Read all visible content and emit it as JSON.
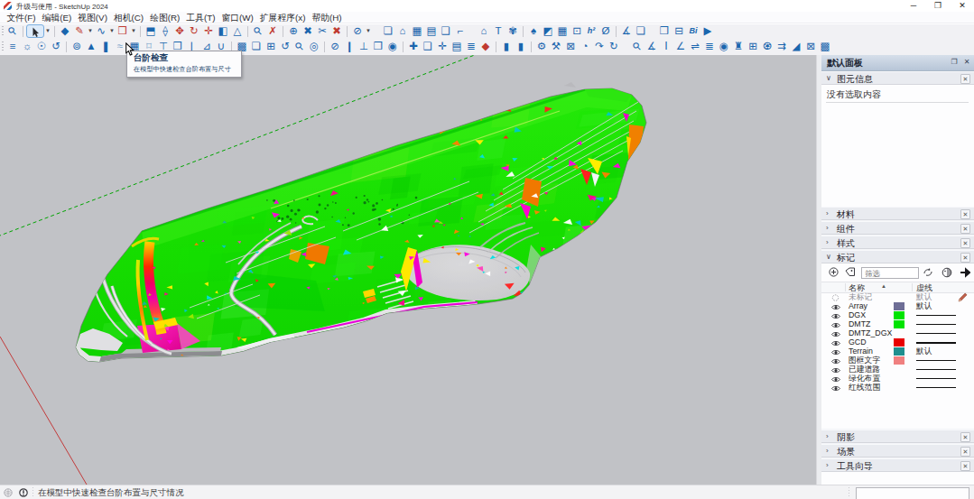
{
  "window": {
    "title": "升级与使用 - SketchUp 2024",
    "minimize_glyph": "─",
    "maximize_glyph": "❐",
    "close_glyph": "✕"
  },
  "menu": {
    "items": [
      "文件(F)",
      "编辑(E)",
      "视图(V)",
      "相机(C)",
      "绘图(R)",
      "工具(T)",
      "窗口(W)",
      "扩展程序(x)",
      "帮助(H)"
    ]
  },
  "toolbar1": {
    "items": [
      {
        "grip": 1
      },
      {
        "n": "zoom-tool",
        "g": "⚲",
        "c": "b",
        "rot": 1
      },
      {
        "sep": 1
      },
      {
        "n": "select-tool",
        "sel": 1
      },
      {
        "n": "select-dropdown",
        "dd": 1
      },
      {
        "sep": 1
      },
      {
        "n": "eraser-tool",
        "g": "◆",
        "c": "b"
      },
      {
        "n": "line-tool",
        "g": "✎",
        "c": "r"
      },
      {
        "n": "line-dropdown",
        "dd": 1
      },
      {
        "n": "arc-tool",
        "g": "∿",
        "c": "b"
      },
      {
        "n": "arc-dropdown",
        "dd": 1
      },
      {
        "n": "rectangle-tool",
        "g": "❒",
        "c": "r"
      },
      {
        "n": "rectangle-dropdown",
        "dd": 1
      },
      {
        "sep": 1
      },
      {
        "n": "pushpull-tool",
        "g": "⬒",
        "c": "b"
      },
      {
        "n": "followme-tool",
        "g": "⟠",
        "c": "b"
      },
      {
        "n": "scale-tool",
        "g": "✥",
        "c": "r"
      },
      {
        "n": "rotate-tool",
        "g": "↻",
        "c": "r"
      },
      {
        "n": "move-tool",
        "g": "✛",
        "c": "r"
      },
      {
        "n": "offset-tool",
        "g": "◧",
        "c": "b"
      },
      {
        "n": "protractor-tool",
        "g": "△",
        "c": "b"
      },
      {
        "sep": 1
      },
      {
        "n": "tape-measure-tool",
        "g": "⚲",
        "c": "b",
        "rot": 1
      },
      {
        "n": "axes-tool",
        "g": "✗",
        "c": "r"
      },
      {
        "sep": 1
      },
      {
        "n": "orbit-tool",
        "g": "⊕",
        "c": "b"
      },
      {
        "n": "pan-tool",
        "g": "✖",
        "c": "b"
      },
      {
        "n": "zoom-extents-tool",
        "g": "✂",
        "c": "b"
      },
      {
        "n": "previous-view-tool",
        "g": "✖",
        "c": "r"
      },
      {
        "sep": 1
      },
      {
        "n": "position-camera-tool",
        "g": "⊘",
        "c": "b"
      },
      {
        "n": "camera-dropdown",
        "dd": 1
      },
      {
        "gap": 1
      },
      {
        "n": "scene-new-button",
        "g": "❏",
        "c": "b"
      },
      {
        "n": "view-iso-button",
        "g": "⌂",
        "c": "b"
      },
      {
        "n": "view-top-button",
        "g": "▦",
        "c": "b"
      },
      {
        "n": "view-front-button",
        "g": "▤",
        "c": "b"
      },
      {
        "n": "view-right-button",
        "g": "❑",
        "c": "b"
      },
      {
        "n": "view-back-button",
        "g": "⌐",
        "c": "b"
      },
      {
        "gap": 1
      },
      {
        "n": "home-tool",
        "g": "⌂",
        "c": "b"
      },
      {
        "n": "text-tool",
        "g": "T",
        "c": "b"
      },
      {
        "n": "flower-component-button",
        "g": "✾",
        "c": "b"
      },
      {
        "sep": 1
      },
      {
        "n": "tree-component-button",
        "g": "♠",
        "c": "b"
      },
      {
        "n": "cube-tool",
        "g": "◩",
        "c": "b"
      },
      {
        "n": "fence-grid-tool",
        "g": "▦",
        "c": "b"
      },
      {
        "n": "boxed-arrow-tool",
        "g": "⊡",
        "c": "b"
      },
      {
        "n": "curve-h2-tool",
        "g": "h²",
        "c": "b",
        "txt": 1
      },
      {
        "n": "hide-rest-tool",
        "g": "Ø",
        "c": "b"
      },
      {
        "sep": 1
      },
      {
        "n": "walk-tool",
        "g": "∡",
        "c": "b"
      },
      {
        "n": "export-doc-tool",
        "g": "❏",
        "c": "b"
      },
      {
        "gap": 1
      },
      {
        "n": "copy-layers-tool",
        "g": "❐",
        "c": "b"
      },
      {
        "n": "minus-box-tool",
        "g": "⊟",
        "c": "b"
      },
      {
        "n": "bim-tool",
        "g": "Bi",
        "c": "b",
        "txt": 1
      },
      {
        "n": "play-tool",
        "g": "▶",
        "c": "b"
      }
    ]
  },
  "toolbar2": {
    "items": [
      {
        "grip": 1
      },
      {
        "n": "layers-list-tool",
        "g": "≡",
        "c": "b"
      },
      {
        "n": "sun-tool",
        "g": "☼",
        "c": "b"
      },
      {
        "n": "globe-tool",
        "g": "☉",
        "c": "b"
      },
      {
        "n": "select-boundary-tool",
        "g": "↺",
        "c": "b"
      },
      {
        "sep": 1
      },
      {
        "n": "helmet-tool",
        "g": "⊚",
        "c": "b"
      },
      {
        "n": "mountain-photo-tool",
        "g": "▲",
        "c": "b"
      },
      {
        "n": "block-tool",
        "g": "❚",
        "c": "b"
      },
      {
        "n": "wave-tool",
        "g": "≈",
        "c": "m"
      },
      {
        "n": "grid-array-tool",
        "g": "▦",
        "c": "b"
      },
      {
        "n": "hovered-tool",
        "g": "⌑",
        "c": "m"
      },
      {
        "n": "pillar-tool",
        "g": "⊤",
        "c": "b"
      },
      {
        "n": "window-frame-tool",
        "g": "❒",
        "c": "b"
      },
      {
        "n": "stairs-down-tool",
        "g": "⌊",
        "c": "b"
      },
      {
        "n": "ramp-tool",
        "g": "⊿",
        "c": "b"
      },
      {
        "n": "pipe-tool",
        "g": "∪",
        "c": "b"
      },
      {
        "sep": 1
      },
      {
        "n": "wall-tool",
        "g": "▩",
        "c": "b"
      },
      {
        "n": "screen-tool",
        "g": "❏",
        "c": "b"
      },
      {
        "n": "attach-tool",
        "g": "⊞",
        "c": "b"
      },
      {
        "n": "loop-tool",
        "g": "↺",
        "c": "b"
      },
      {
        "n": "magnify-plus-tool",
        "g": "⚲",
        "c": "b",
        "rot": 1
      },
      {
        "n": "download-circle-tool",
        "g": "◎",
        "c": "b"
      },
      {
        "sep": 1
      },
      {
        "n": "link-tool",
        "g": "⊘",
        "c": "b"
      },
      {
        "n": "fence-tool",
        "g": "❙",
        "c": "b"
      },
      {
        "n": "figure-tool",
        "g": "⊥",
        "c": "b"
      },
      {
        "n": "transfer-tool",
        "g": "❐",
        "c": "b"
      },
      {
        "n": "lock-box-tool",
        "g": "◉",
        "c": "b"
      },
      {
        "sep": 1
      },
      {
        "n": "add-wall-tool",
        "g": "✚",
        "c": "b"
      },
      {
        "n": "note-edit-tool",
        "g": "❑",
        "c": "b"
      },
      {
        "n": "cross-move-tool",
        "g": "✛",
        "c": "b"
      },
      {
        "n": "list-table-tool",
        "g": "▤",
        "c": "b"
      },
      {
        "n": "equalizer-tool",
        "g": "≣",
        "c": "b"
      },
      {
        "n": "trash-red-tool",
        "g": "◆",
        "c": "r"
      },
      {
        "sep": 1
      },
      {
        "n": "battery1-tool",
        "g": "▮",
        "c": "b"
      },
      {
        "n": "battery2-tool",
        "g": "▮",
        "c": "b"
      },
      {
        "sep": 1
      },
      {
        "n": "gear-tool",
        "g": "⚙",
        "c": "b"
      },
      {
        "n": "gear-run-tool",
        "g": "⚒",
        "c": "b"
      },
      {
        "n": "photo-match-tool",
        "g": "⊠",
        "c": "b"
      },
      {
        "n": "help-circle-tool",
        "g": "◔",
        "c": "b"
      },
      {
        "n": "cloud-up-tool",
        "g": "↷",
        "c": "b"
      },
      {
        "n": "refresh-tool",
        "g": "↻",
        "c": "b"
      },
      {
        "gap": 1
      },
      {
        "n": "search-big-tool",
        "g": "⚲",
        "c": "b",
        "rot": 1
      },
      {
        "n": "angle-tool",
        "g": "∡",
        "c": "b"
      },
      {
        "n": "height-tool",
        "g": "Ⅰ",
        "c": "b"
      },
      {
        "n": "slope-tool",
        "g": "∠",
        "c": "b"
      },
      {
        "n": "swap-tool",
        "g": "⇌",
        "c": "b"
      },
      {
        "n": "layers-tool",
        "g": "≣",
        "c": "b"
      },
      {
        "n": "lock-tool",
        "g": "◉",
        "c": "b"
      },
      {
        "n": "tower-tool",
        "g": "♜",
        "c": "b"
      },
      {
        "n": "window-grid-tool",
        "g": "⊞",
        "c": "b"
      },
      {
        "n": "trash-can-tool",
        "g": "♼",
        "c": "b"
      },
      {
        "n": "branch-tool",
        "g": "⇉",
        "c": "b"
      },
      {
        "n": "terrain-slope-tool",
        "g": "◢",
        "c": "b"
      },
      {
        "n": "screen-arrow-tool",
        "g": "⊠",
        "c": "b"
      },
      {
        "n": "texture-tool",
        "g": "▩",
        "c": "b"
      }
    ]
  },
  "tooltip": {
    "title": "台阶检查",
    "description": "在模型中快速检查台阶布置与尺寸"
  },
  "viewport": {
    "background": "#c1c2c6",
    "green_axis_color": "#00a400",
    "red_axis_color": "#c23a3a",
    "model_primary_color": "#1ae300"
  },
  "tray": {
    "title": "默认面板",
    "pin_glyph": "❐",
    "close_glyph": "✕",
    "entity_info": {
      "title": "图元信息",
      "empty_text": "没有选取内容"
    },
    "materials": {
      "title": "材料"
    },
    "components": {
      "title": "组件"
    },
    "styles": {
      "title": "样式"
    },
    "tags": {
      "title": "标记",
      "search_placeholder": "筛选",
      "name_column": "名称",
      "dashes_column": "虚线",
      "default_dash_label": "默认",
      "rows": [
        {
          "name": "未标记",
          "untagged": true,
          "dash": "default",
          "active": true
        },
        {
          "name": "Array",
          "color": "#6e6e96",
          "dash": "default"
        },
        {
          "name": "DGX",
          "color": "#00e400",
          "dash": "line"
        },
        {
          "name": "DMTZ",
          "color": "#00e400",
          "dash": "line"
        },
        {
          "name": "DMTZ_DGX",
          "color": "",
          "dash": "line"
        },
        {
          "name": "GCD",
          "color": "#e80000",
          "dash": "thick"
        },
        {
          "name": "Terrain",
          "color": "#1f8f8f",
          "dash": "default"
        },
        {
          "name": "图框文字",
          "color": "#f08080",
          "dash": "line"
        },
        {
          "name": "已建道路",
          "color": "",
          "dash": "line"
        },
        {
          "name": "绿化布置",
          "color": "",
          "dash": "line"
        },
        {
          "name": "红线范围",
          "color": "",
          "dash": "line"
        }
      ]
    },
    "shadows": {
      "title": "阴影"
    },
    "scenes": {
      "title": "场景"
    },
    "instructor": {
      "title": "工具向导"
    }
  },
  "statusbar": {
    "hint": "在模型中快速检查台阶布置与尺寸情况"
  }
}
